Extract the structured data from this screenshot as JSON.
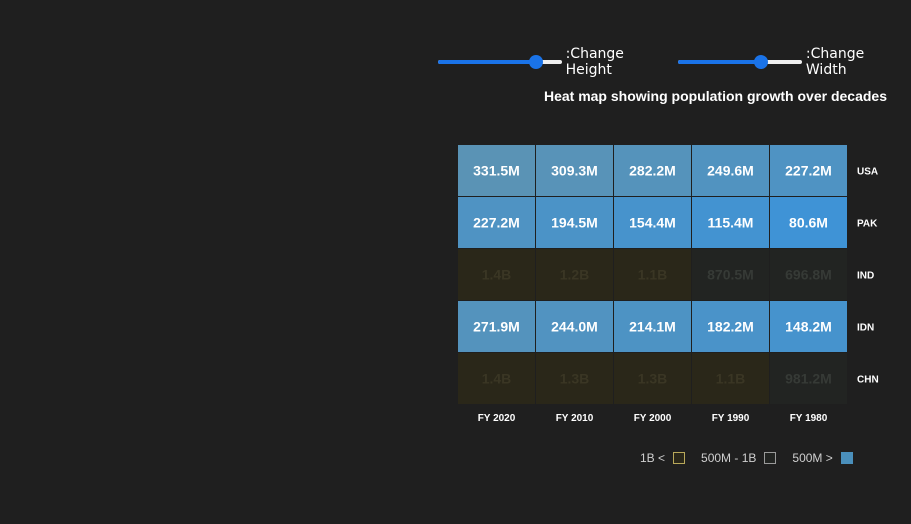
{
  "controls": {
    "height_label": ":Change Height",
    "width_label": ":Change Width",
    "height_value": 0.78,
    "width_value": 0.66
  },
  "chart_title": "Heat map showing population growth over decades",
  "chart_data": {
    "type": "heatmap",
    "title": "Heat map showing population growth over decades",
    "x": [
      "FY 2020",
      "FY 2010",
      "FY 2000",
      "FY 1990",
      "FY 1980"
    ],
    "y": [
      "USA",
      "PAK",
      "IND",
      "IDN",
      "CHN"
    ],
    "values": [
      [
        331.5,
        309.3,
        282.2,
        249.6,
        227.2
      ],
      [
        227.2,
        194.5,
        154.4,
        115.4,
        80.6
      ],
      [
        1400,
        1200,
        1100,
        870.5,
        696.8
      ],
      [
        271.9,
        244.0,
        214.1,
        182.2,
        148.2
      ],
      [
        1400,
        1300,
        1300,
        1100,
        981.2
      ]
    ],
    "labels": [
      [
        "331.5M",
        "309.3M",
        "282.2M",
        "249.6M",
        "227.2M"
      ],
      [
        "227.2M",
        "194.5M",
        "154.4M",
        "115.4M",
        "80.6M"
      ],
      [
        "1.4B",
        "1.2B",
        "1.1B",
        "870.5M",
        "696.8M"
      ],
      [
        "271.9M",
        "244.0M",
        "214.1M",
        "182.2M",
        "148.2M"
      ],
      [
        "1.4B",
        "1.3B",
        "1.3B",
        "1.1B",
        "981.2M"
      ]
    ],
    "legend": [
      {
        "label": "1B <",
        "color": "#2a2719",
        "border": "#b8a85a"
      },
      {
        "label": "500M - 1B",
        "color": "#222422",
        "border": "#9a9a9a"
      },
      {
        "label": "500M >",
        "color": "#4a8fbb",
        "border": "#4a8fbb"
      }
    ],
    "colors": {
      "high": "#2a2719",
      "mid": "#222422",
      "low_light": "#5a93b5",
      "low_dark": "#3f93d6",
      "label_light": "#ffffff",
      "label_dark_b": "#3a3624",
      "label_dark_m": "#363a36",
      "grid": "#1f1f1f"
    }
  }
}
